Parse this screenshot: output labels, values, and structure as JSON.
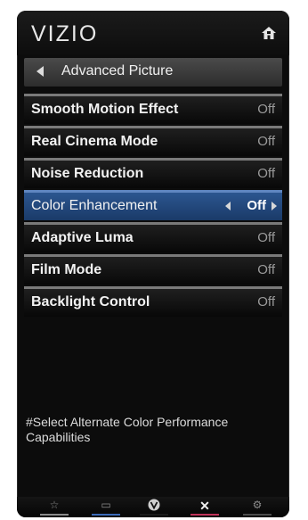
{
  "header": {
    "logo": "VIZIO",
    "home_icon": "home-icon"
  },
  "nav": {
    "back_label": "Advanced Picture"
  },
  "menu": {
    "items": [
      {
        "label": "Smooth Motion Effect",
        "value": "Off"
      },
      {
        "label": "Real Cinema Mode",
        "value": "Off"
      },
      {
        "label": "Noise Reduction",
        "value": "Off"
      },
      {
        "label": "Color Enhancement",
        "value": "Off",
        "selected": true
      },
      {
        "label": "Adaptive Luma",
        "value": "Off"
      },
      {
        "label": "Film Mode",
        "value": "Off"
      },
      {
        "label": "Backlight Control",
        "value": "Off"
      }
    ]
  },
  "help_text": "#Select Alternate Color Performance Capabilities",
  "footer": {
    "buttons": [
      {
        "icon": "star-icon",
        "glyph": "☆"
      },
      {
        "icon": "info-icon",
        "glyph": "▭"
      },
      {
        "icon": "v-icon",
        "glyph": "V"
      },
      {
        "icon": "close-icon",
        "glyph": "✕"
      },
      {
        "icon": "gear-icon",
        "glyph": "⚙"
      }
    ]
  },
  "colors": {
    "selected_row": "#2c5690",
    "accent_blue": "#3b6ab8",
    "accent_red": "#c0325a"
  }
}
